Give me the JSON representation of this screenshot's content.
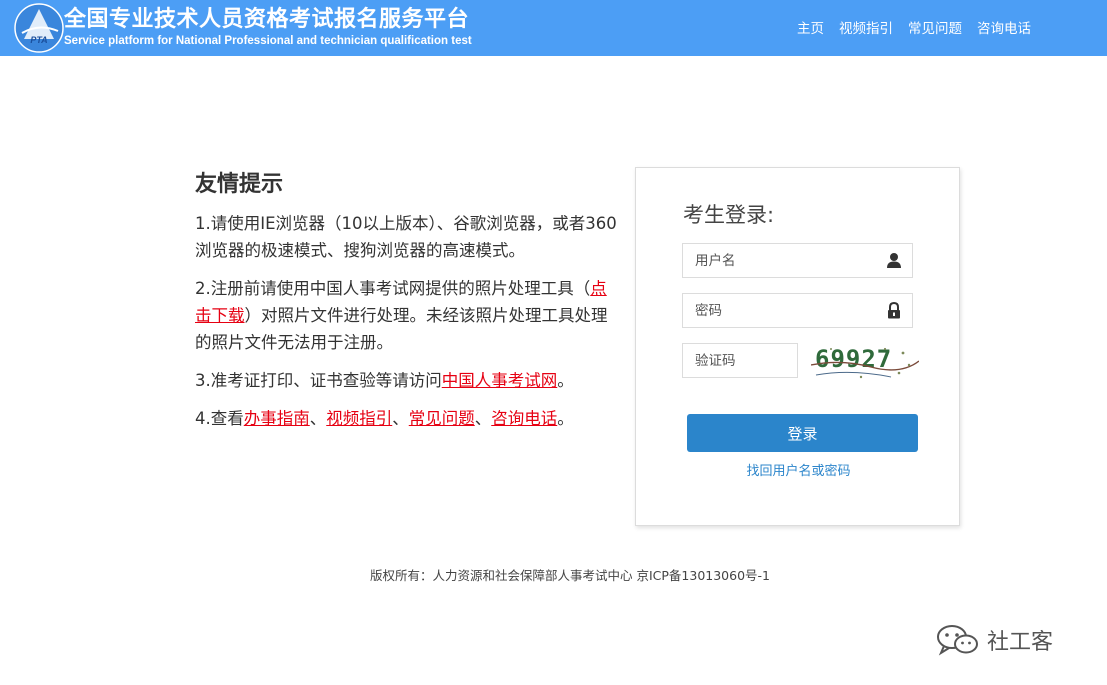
{
  "header": {
    "logo_text": "PTA",
    "title": "全国专业技术人员资格考试报名服务平台",
    "subtitle": "Service platform for National Professional and technician qualification test",
    "nav": [
      "主页",
      "视频指引",
      "常见问题",
      "咨询电话"
    ]
  },
  "tips": {
    "heading": "友情提示",
    "item1": "1.请使用IE浏览器（10以上版本）、谷歌浏览器，或者360浏览器的极速模式、搜狗浏览器的高速模式。",
    "item2_pre": "2.注册前请使用中国人事考试网提供的照片处理工具（",
    "item2_link": "点击下载",
    "item2_post": "）对照片文件进行处理。未经该照片处理工具处理的照片文件无法用于注册。",
    "item3_pre": "3.准考证打印、证书查验等请访问",
    "item3_link": "中国人事考试网",
    "item3_post": "。",
    "item4_pre": "4.查看",
    "item4_link1": "办事指南",
    "sep": "、",
    "item4_link2": "视频指引",
    "item4_link3": "常见问题",
    "item4_link4": "咨询电话",
    "item4_post": "。"
  },
  "login": {
    "title": "考生登录:",
    "username_placeholder": "用户名",
    "password_placeholder": "密码",
    "captcha_placeholder": "验证码",
    "captcha_text": "69927",
    "submit_label": "登录",
    "forgot_label": "找回用户名或密码"
  },
  "footer": {
    "copyright": "版权所有：人力资源和社会保障部人事考试中心 京ICP备13013060号-1"
  },
  "watermark": {
    "text": "社工客",
    "icon": "wechat-icon"
  },
  "colors": {
    "header_bg": "#4c9ef5",
    "link_red": "#e60012",
    "button_blue": "#2b85cb"
  }
}
